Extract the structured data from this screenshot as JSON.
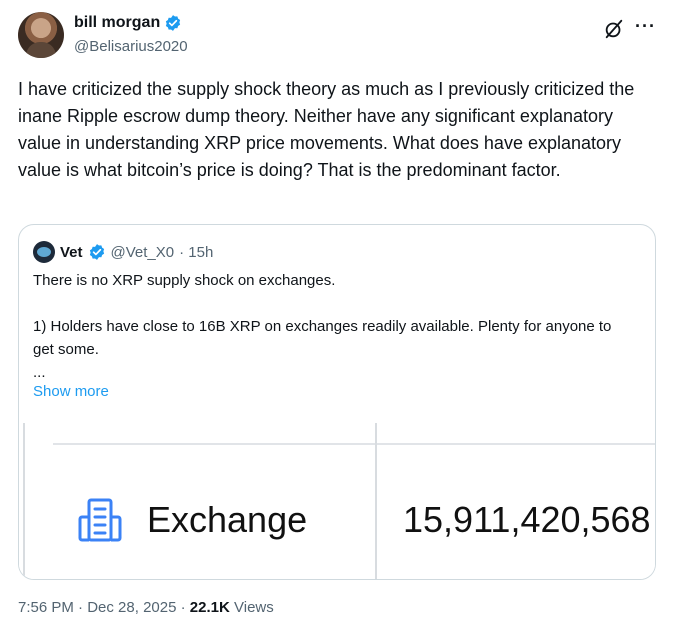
{
  "author": {
    "name": "bill morgan",
    "handle": "@Belisarius2020"
  },
  "tweet": {
    "text": "I have criticized the supply shock theory as much as I previously criticized the inane Ripple escrow dump theory. Neither have any significant explanatory value in understanding XRP price movements. What does have explanatory value is what bitcoin’s price is doing? That is the predominant factor."
  },
  "quote": {
    "name": "Vet",
    "handle": "@Vet_X0",
    "time": "· 15h",
    "text": "There is no XRP supply shock on exchanges.\n\n1) Holders have close to 16B XRP on exchanges readily available. Plenty for anyone to get some.\n...",
    "show_more": "Show more",
    "image": {
      "label": "Exchange",
      "value": "15,911,420,568"
    }
  },
  "meta": {
    "time": "7:56 PM",
    "date": "Dec 28, 2025",
    "views_count": "22.1K",
    "views_label": "Views"
  },
  "colors": {
    "verified": "#1d9bf0",
    "link": "#1d9bf0",
    "secondary_text": "#536471"
  },
  "icons": [
    "verified-badge-icon",
    "grok-icon",
    "more-icon",
    "building-icon"
  ]
}
